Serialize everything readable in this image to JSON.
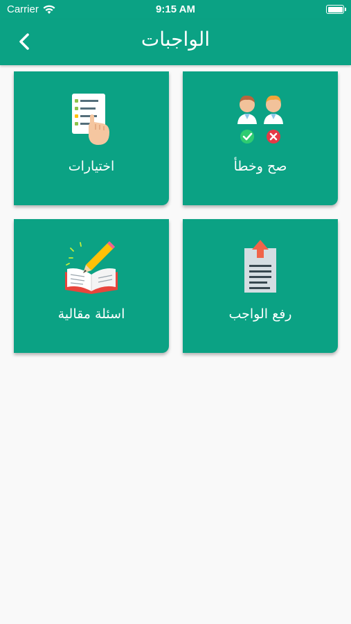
{
  "status_bar": {
    "carrier": "Carrier",
    "time": "9:15 AM",
    "icons": [
      "wifi-icon",
      "battery-icon"
    ]
  },
  "nav": {
    "title": "الواجبات",
    "back_icon": "chevron-left-icon"
  },
  "cards": [
    {
      "id": "true-false",
      "label": "صح وخطأ",
      "icon": "true-false-people-icon"
    },
    {
      "id": "multiple-choice",
      "label": "اختيارات",
      "icon": "checklist-hand-icon"
    },
    {
      "id": "upload-homework",
      "label": "رفع الواجب",
      "icon": "document-upload-icon"
    },
    {
      "id": "essay-questions",
      "label": "اسئلة مقالية",
      "icon": "book-pencil-icon"
    }
  ],
  "colors": {
    "primary": "#0ba284",
    "background": "#f9f9f9",
    "text_on_primary": "#ffffff"
  }
}
